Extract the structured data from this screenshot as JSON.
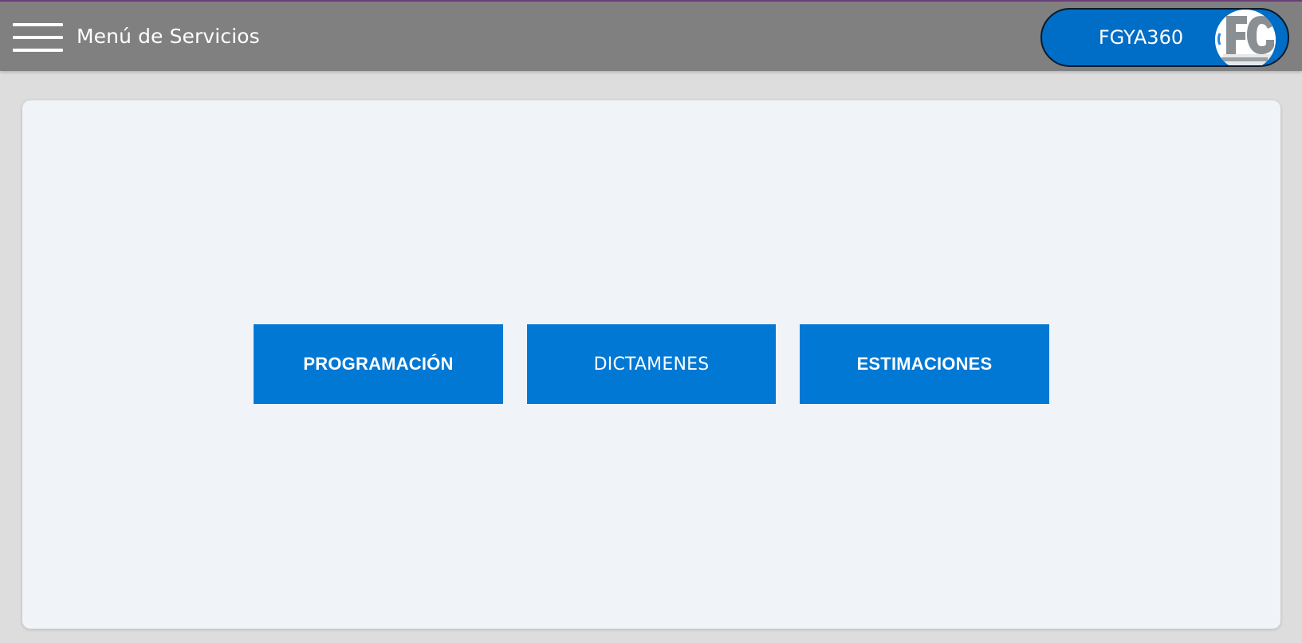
{
  "header": {
    "title": "Menú de Servicios",
    "menu_icon": "hamburger-menu-icon",
    "background_color": "#808080"
  },
  "user": {
    "name": "FGYA360",
    "avatar_icon": "company-logo-avatar",
    "pill_color": "#006dc6"
  },
  "services": [
    {
      "label": "PROGRAMACIÓN"
    },
    {
      "label": "DICTAMENES"
    },
    {
      "label": "ESTIMACIONES"
    }
  ],
  "colors": {
    "button": "#0078d4",
    "card": "#f0f4f9",
    "page_background": "#dddddd"
  }
}
